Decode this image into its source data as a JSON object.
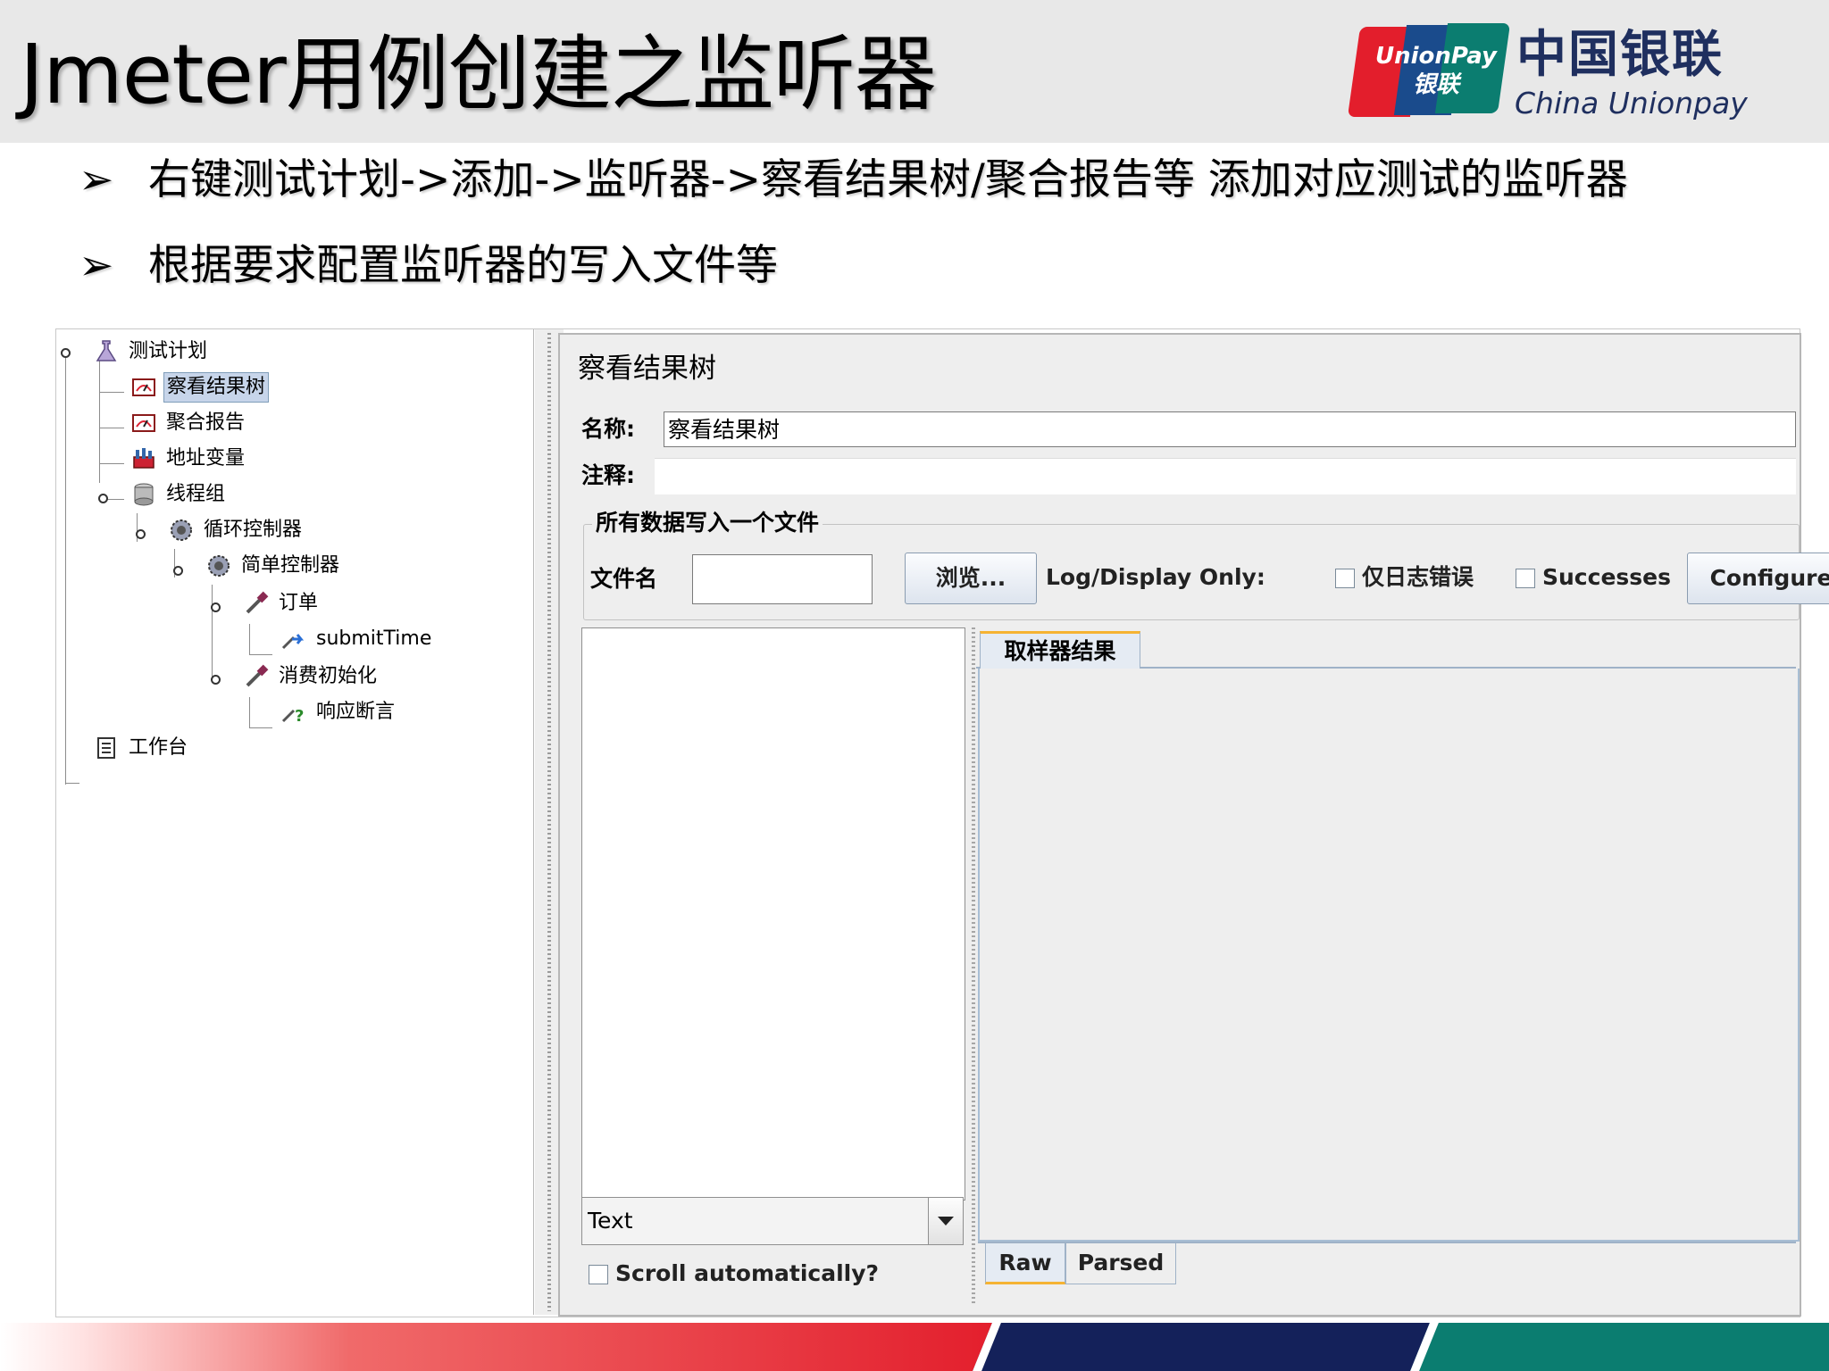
{
  "slide": {
    "title": "Jmeter用例创建之监听器",
    "bullet_mark": "➢",
    "bullets": [
      "右键测试计划->添加->监听器->察看结果树/聚合报告等 添加对应测试的监听器",
      "根据要求配置监听器的写入文件等"
    ]
  },
  "logo": {
    "en_box": "UnionPay",
    "cn_box": "银联",
    "cn": "中国银联",
    "en": "China Unionpay",
    "colors": {
      "red": "#e31e2c",
      "blue": "#1a4b8c",
      "teal": "#0b7d70"
    }
  },
  "tree": {
    "nodes": [
      {
        "label": "测试计划",
        "icon": "flask-icon"
      },
      {
        "label": "察看结果树",
        "icon": "listener-icon",
        "selected": true
      },
      {
        "label": "聚合报告",
        "icon": "listener-icon"
      },
      {
        "label": "地址变量",
        "icon": "config-element-icon"
      },
      {
        "label": "线程组",
        "icon": "thread-group-icon"
      },
      {
        "label": "循环控制器",
        "icon": "controller-icon"
      },
      {
        "label": "简单控制器",
        "icon": "controller-icon"
      },
      {
        "label": "订单",
        "icon": "sampler-icon"
      },
      {
        "label": "submitTime",
        "icon": "post-processor-icon"
      },
      {
        "label": "消费初始化",
        "icon": "sampler-icon"
      },
      {
        "label": "响应断言",
        "icon": "assertion-icon"
      },
      {
        "label": "工作台",
        "icon": "workbench-icon"
      }
    ]
  },
  "panel": {
    "title": "察看结果树",
    "name_label": "名称:",
    "name_value": "察看结果树",
    "comment_label": "注释:",
    "comment_value": "",
    "group_title": "所有数据写入一个文件",
    "filename_label": "文件名",
    "filename_value": "",
    "browse_button": "浏览...",
    "log_display_label": "Log/Display Only:",
    "errors_only_label": "仅日志错误",
    "successes_label": "Successes",
    "configure_button": "Configure",
    "renderer_select": "Text",
    "scroll_label": "Scroll automatically?",
    "result_tab": "取样器结果",
    "bottom_tabs": [
      "Raw",
      "Parsed"
    ]
  }
}
